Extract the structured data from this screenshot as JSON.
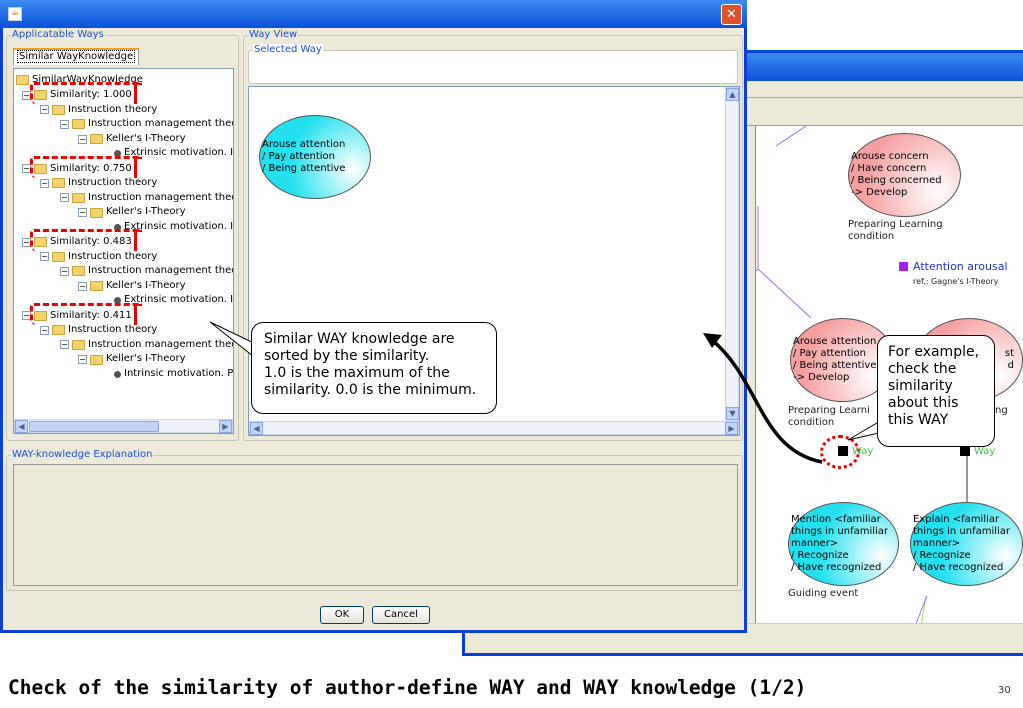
{
  "dialog": {
    "panel_left_title": "Applicatable Ways",
    "tab": "Similar WayKnowledge",
    "tree": {
      "root": "SimilarWayKnowledge",
      "groups": [
        {
          "similarity": "Similarity: 1.000",
          "theory": "Instruction theory",
          "sub": "Instruction management theor",
          "keller": "Keller's I-Theory",
          "leaf": "Extrinsic motivation. I"
        },
        {
          "similarity": "Similarity: 0.750",
          "theory": "Instruction theory",
          "sub": "Instruction management theor",
          "keller": "Keller's I-Theory",
          "leaf": "Extrinsic motivation. I"
        },
        {
          "similarity": "Similarity: 0.483",
          "theory": "Instruction theory",
          "sub": "Instruction management theor",
          "keller": "Keller's I-Theory",
          "leaf": "Extrinsic motivation. I"
        },
        {
          "similarity": "Similarity: 0.411",
          "theory": "Instruction theory",
          "sub": "Instruction management theor",
          "keller": "Keller's I-Theory",
          "leaf": "Intrinsic motivation. P"
        }
      ]
    },
    "way_view_title": "Way View",
    "selected_way_title": "Selected Way",
    "way_node": "Arouse attention\n/ Pay attention\n/ Being attentive",
    "explanation_title": "WAY-knowledge Explanation",
    "ok": "OK",
    "cancel": "Cancel"
  },
  "background_window": {
    "node_top": "Arouse concern\n/ Have concern\n/ Being concerned\n-> Develop",
    "label_top": "Preparing Learning\ncondition",
    "way_top": "Attention arousal",
    "way_top_ref": "ref.: Gagne's I-Theory",
    "node_mid_left": "Arouse attention\n/ Pay attention\n/ Being attentive\n-> Develop",
    "node_mid_right": "st\nd",
    "label_mid_left": "Preparing Learni\ncondition",
    "label_mid_right": "ng",
    "way_left": "Way",
    "way_right": "Way",
    "node_bottom_left": "Mention <familiar\nthings in unfamiliar\nmanner>\n/ Recognize\n/ Have recognized",
    "node_bottom_right": "Explain <familiar\nthings in unfamiliar\nmanner>\n/ Recognize\n/ Have recognized",
    "label_bottom": "Guiding event"
  },
  "callouts": {
    "left": "Similar WAY knowledge are\nsorted by the similarity.\n1.0 is the maximum of the\nsimilarity. 0.0 is the minimum.",
    "right": "For example,\ncheck the\nsimilarity\nabout this\nthis WAY"
  },
  "slide": {
    "caption": "Check of the similarity of author-define WAY and WAY knowledge (1/2)",
    "page": "30"
  }
}
